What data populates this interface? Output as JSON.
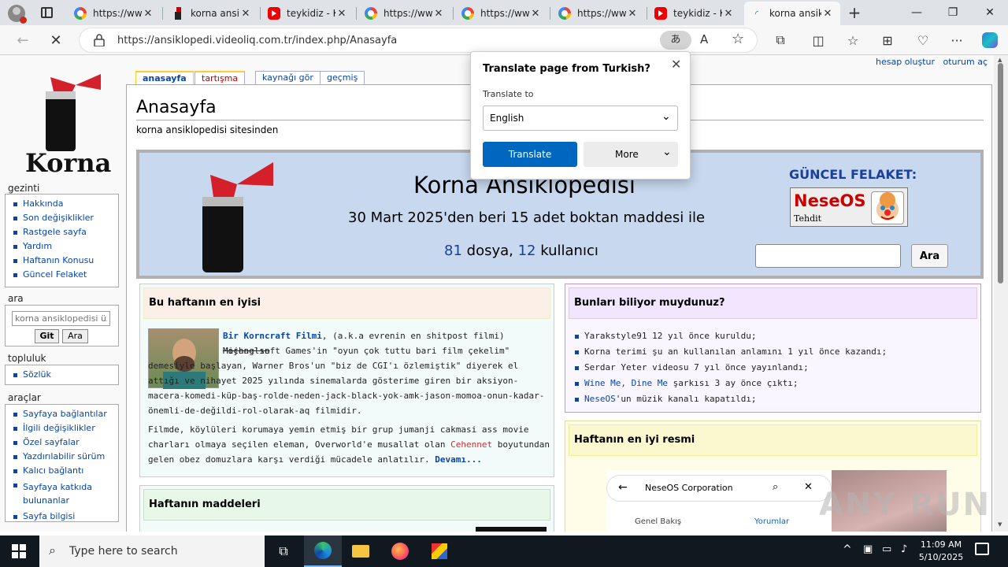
{
  "browser": {
    "tabs": [
      {
        "title": "https://www",
        "favicon": "google"
      },
      {
        "title": "korna ansik",
        "favicon": "korna"
      },
      {
        "title": "teykidiz - K",
        "favicon": "youtube"
      },
      {
        "title": "https://www",
        "favicon": "google"
      },
      {
        "title": "https://www",
        "favicon": "google"
      },
      {
        "title": "https://www",
        "favicon": "google"
      },
      {
        "title": "teykidiz - K",
        "favicon": "youtube"
      },
      {
        "title": "korna ansik",
        "favicon": "korna"
      }
    ],
    "url": "https://ansiklopedi.videoliq.com.tr/index.php/Anasayfa"
  },
  "toplinks": {
    "create": "hesap oluştur",
    "login": "oturum aç"
  },
  "page_tabs": [
    "anasayfa",
    "tartışma",
    "kaynağı gör",
    "geçmiş"
  ],
  "logo_text": "Korna",
  "sidebar": {
    "nav_head": "gezinti",
    "nav": [
      "Hakkında",
      "Son değişiklikler",
      "Rastgele sayfa",
      "Yardım",
      "Haftanın Konusu",
      "Güncel Felakets"
    ],
    "search_head": "ara",
    "search_placeholder": "korna ansiklopedisi üz",
    "search_go": "Git",
    "search_btn": "Ara",
    "community_head": "topluluk",
    "community": [
      "Sözlük"
    ],
    "tools_head": "araçlar",
    "tools": [
      "Sayfaya bağlantılar",
      "İlgili değişiklikler",
      "Özel sayfalar",
      "Yazdırılabilir sürüm",
      "Kalıcı bağlantı",
      "Sayfaya katkıda bulunanlar",
      "Sayfa bilgisi"
    ]
  },
  "page": {
    "title": "Anasayfa",
    "subtitle": "korna ansiklopedisi sitesinden"
  },
  "banner": {
    "title": "Korna Ansiklopedisi",
    "subtitle": "30 Mart 2025'den beri 15 adet boktan maddesi ile",
    "files": "81",
    "files_label": "dosya,",
    "users": "12",
    "users_label": "kullanıcı",
    "disaster_label": "GÜNCEL FELAKET:",
    "neseos_title": "NeseOS",
    "neseos_sub": "Tehdit",
    "search_btn": "Ara"
  },
  "best": {
    "head": "Bu haftanın en iyisi",
    "link": "Bir Korncraft Filmi",
    "t1": ", (a.k.a evrenin en shitpost filmi) ",
    "strike": "Mojang'ın",
    "t2": " Michaelsoft Games'in \"oyun çok tuttu bari film çekelim\" demesiyle başlayan, Warner Bros'un \"biz de CGI'ı özlemiştik\" diyerek el attığı ve nihayet 2025 yılında sinemalarda gösterime giren bir aksiyon-macera-komedi-küp-baş-rolde-neden-jack-black-yok-amk-jason-momoa-onun-kadar-önemli-de-değildi-rol-olarak-aq filmidir.",
    "p2a": "Filmde, köylüleri korumaya yemin etmiş bir grup jumanji cakmasi ass movie charları olmaya seçilen eleman, Overworld'e musallat olan ",
    "p2red": "Cehennet",
    "p2b": " boyutundan gelen obez domuzlara karşı verdiği mücadele anlatılır. ",
    "more": "Devamı..."
  },
  "facts": {
    "head": "Bunları biliyor muydunuz?",
    "items": [
      {
        "pre": "",
        "link": "",
        "text": "Yarakstyle91 12 yıl önce kuruldu;"
      },
      {
        "pre": "",
        "link": "",
        "text": "Korna terimi şu an kullanılan anlamını 1 yıl önce kazandı;"
      },
      {
        "pre": "",
        "link": "",
        "text": "Serdar Yeter videosu 7 yıl önce yayınlandı;"
      },
      {
        "pre": "",
        "link": "Wine Me, Dine Me",
        "text": " şarkısı 3 ay önce çıktı;"
      },
      {
        "pre": "",
        "link": "NeseOS",
        "text": "'un müzik kanalı kapatıldı;"
      }
    ]
  },
  "articles": {
    "head": "Haftanın maddeleri"
  },
  "picture": {
    "head": "Haftanın en iyi resmi",
    "search_text": "NeseOS Corporation",
    "tab1": "Genel Bakış",
    "tab2": "Yorumlar"
  },
  "translate": {
    "title": "Translate page from Turkish?",
    "to_label": "Translate to",
    "language": "English",
    "translate_btn": "Translate",
    "more_btn": "More"
  },
  "taskbar": {
    "search_placeholder": "Type here to search",
    "time": "11:09 AM",
    "date": "5/10/2025"
  },
  "watermark": "ANY RUN",
  "colors": {
    "accent": "#0067c0",
    "link": "#0645ad",
    "banner": "#c8d8ee"
  }
}
